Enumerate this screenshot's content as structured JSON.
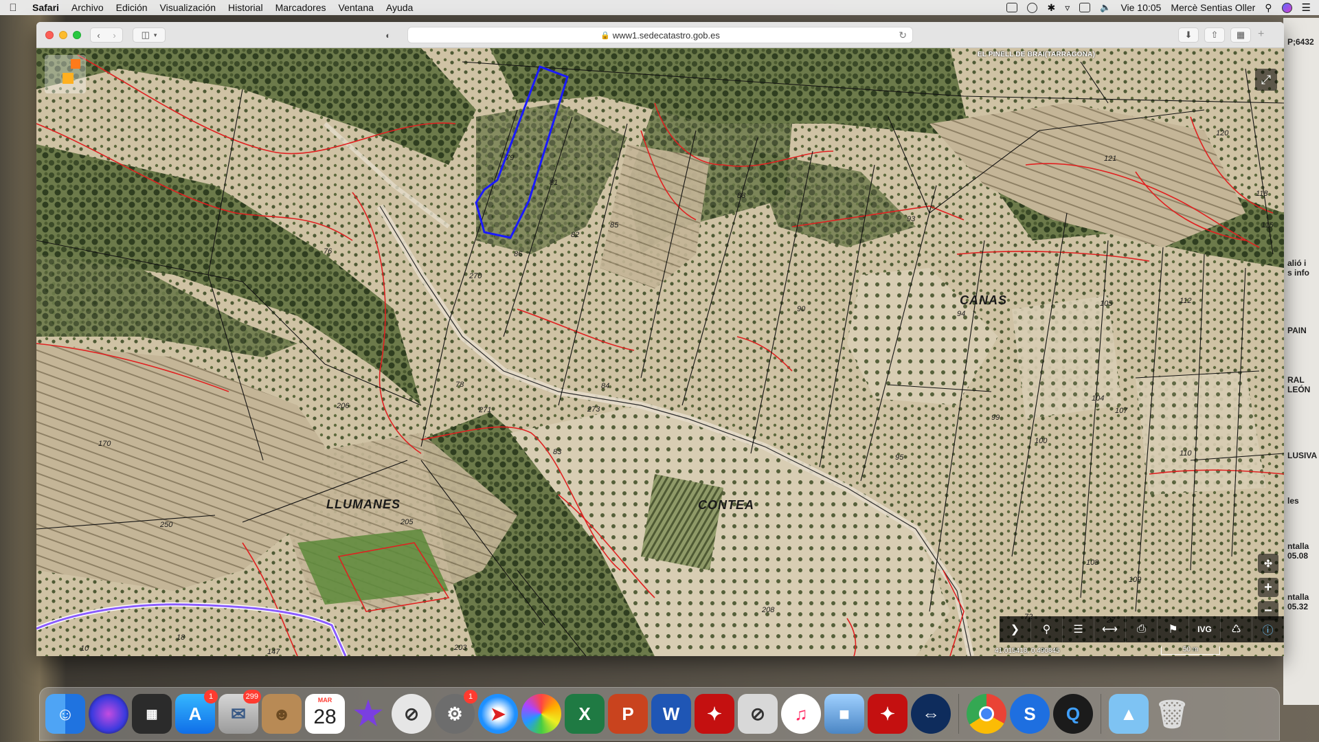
{
  "menubar": {
    "app_name": "Safari",
    "menus": [
      "Archivo",
      "Edición",
      "Visualización",
      "Historial",
      "Marcadores",
      "Ventana",
      "Ayuda"
    ],
    "clock": "Vie 10:05",
    "user": "Mercè Sentias Oller"
  },
  "browser": {
    "url": "www1.sedecatastro.gob.es"
  },
  "map": {
    "municipality_label": "EL PINELL DE BRAI(TARRAGONA)",
    "place_names": [
      "CANAS",
      "LLUMANES",
      "CONTEA"
    ],
    "parcel_numbers": [
      "79",
      "81",
      "76",
      "82",
      "85",
      "88",
      "86",
      "270",
      "78",
      "271",
      "273",
      "84",
      "83",
      "206",
      "170",
      "250",
      "205",
      "93",
      "90",
      "94",
      "95",
      "99",
      "100",
      "104",
      "105",
      "107",
      "108",
      "109",
      "110",
      "112",
      "120",
      "121",
      "118",
      "116",
      "208",
      "203",
      "10",
      "147",
      "18",
      "72",
      "27"
    ],
    "coordinates": "41.015418, 0.490845",
    "scale": "50 m",
    "toolbar_tools": [
      "next-arrow",
      "search",
      "layers",
      "measure",
      "print",
      "cadastral-ref",
      "IVG",
      "sync",
      "info"
    ],
    "ivg_label": "IVG",
    "colors": {
      "parcel_boundary": "#e02020",
      "selected_parcel": "#1a1aff",
      "municipal_boundary": "#8a5cff"
    }
  },
  "desktop_side_text": [
    "P;6432",
    "alió i",
    "s info",
    "PAIN",
    "RAL",
    "LEÓN",
    "LUSIVA",
    "les",
    "ntalla",
    "05.08",
    "ntalla",
    "05.32"
  ],
  "dock": {
    "calendar_month": "MAR",
    "calendar_day": "28",
    "appstore_badge": "1",
    "mail_badge": "299",
    "settings_badge": "1"
  }
}
